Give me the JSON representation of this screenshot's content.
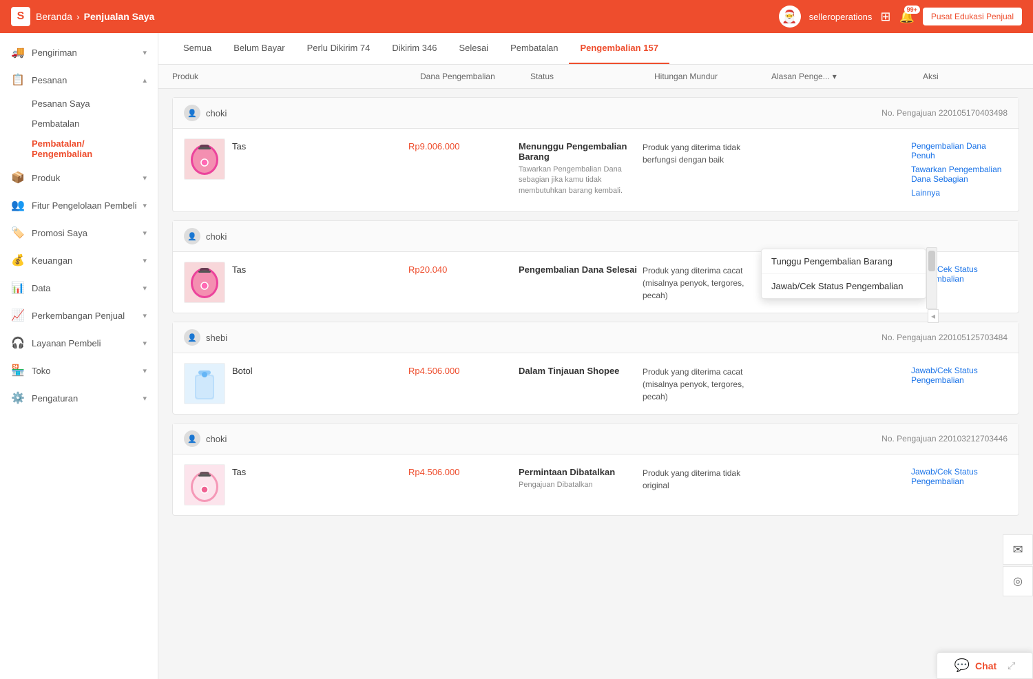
{
  "navbar": {
    "logo": "S",
    "breadcrumb_home": "Beranda",
    "breadcrumb_sep": "›",
    "breadcrumb_current": "Penjualan Saya",
    "username": "selleroperations",
    "notif_badge": "99+",
    "edu_button": "Pusat Edukasi Penjual"
  },
  "sidebar": {
    "items": [
      {
        "id": "pengiriman",
        "icon": "🚚",
        "label": "Pengiriman",
        "chevron": "▾"
      },
      {
        "id": "pesanan",
        "icon": "📋",
        "label": "Pesanan",
        "chevron": "▴",
        "expanded": true
      },
      {
        "id": "produk",
        "icon": "📦",
        "label": "Produk",
        "chevron": "▾"
      },
      {
        "id": "fitur",
        "icon": "👥",
        "label": "Fitur Pengelolaan Pembeli",
        "chevron": "▾"
      },
      {
        "id": "promosi",
        "icon": "🏷️",
        "label": "Promosi Saya",
        "chevron": "▾"
      },
      {
        "id": "keuangan",
        "icon": "💰",
        "label": "Keuangan",
        "chevron": "▾"
      },
      {
        "id": "data",
        "icon": "📊",
        "label": "Data",
        "chevron": "▾"
      },
      {
        "id": "perkembangan",
        "icon": "📈",
        "label": "Perkembangan Penjual",
        "chevron": "▾"
      },
      {
        "id": "layanan",
        "icon": "🎧",
        "label": "Layanan Pembeli",
        "chevron": "▾"
      },
      {
        "id": "toko",
        "icon": "🏪",
        "label": "Toko",
        "chevron": "▾"
      },
      {
        "id": "pengaturan",
        "icon": "⚙️",
        "label": "Pengaturan",
        "chevron": "▾"
      }
    ],
    "sub_pesanan": [
      {
        "id": "pesanan-saya",
        "label": "Pesanan Saya",
        "active": false
      },
      {
        "id": "pembatalan",
        "label": "Pembatalan",
        "active": false
      },
      {
        "id": "pembatalan-pengembalian",
        "label": "Pembatalan/ Pengembalian",
        "active": true
      }
    ]
  },
  "tabs": [
    {
      "id": "semua",
      "label": "Semua",
      "active": false
    },
    {
      "id": "belum-bayar",
      "label": "Belum Bayar",
      "active": false
    },
    {
      "id": "perlu-dikirim",
      "label": "Perlu Dikirim",
      "badge": "74",
      "active": false
    },
    {
      "id": "dikirim",
      "label": "Dikirim",
      "badge": "346",
      "active": false
    },
    {
      "id": "selesai",
      "label": "Selesai",
      "active": false
    },
    {
      "id": "pembatalan",
      "label": "Pembatalan",
      "active": false
    },
    {
      "id": "pengembalian",
      "label": "Pengembalian",
      "badge": "157",
      "active": true
    }
  ],
  "table_header": {
    "produk": "Produk",
    "dana": "Dana Pengembalian",
    "status": "Status",
    "hitungan": "Hitungan Mundur",
    "alasan": "Alasan Penge...",
    "aksi": "Aksi"
  },
  "orders": [
    {
      "id": "order1",
      "user": "choki",
      "submission_no": "No. Pengajuan 220105170403498",
      "product_name": "Tas",
      "product_emoji": "🎒",
      "product_color": "pink",
      "price": "Rp9.006.000",
      "status_main": "Menunggu Pengembalian Barang",
      "status_sub": "Tawarkan Pengembalian Dana sebagian jika kamu tidak membutuhkan barang kembali.",
      "reason": "Produk yang diterima tidak berfungsi dengan baik",
      "actions": [
        {
          "label": "Pengembalian Dana Penuh",
          "type": "primary"
        },
        {
          "label": "Tawarkan Pengembalian Dana Sebagian",
          "type": "primary"
        },
        {
          "label": "Lainnya",
          "type": "primary"
        }
      ]
    },
    {
      "id": "order2",
      "user": "choki",
      "submission_no": "",
      "product_name": "Tas",
      "product_emoji": "🎒",
      "product_color": "pink",
      "price": "Rp20.040",
      "status_main": "Pengembalian Dana Selesai",
      "status_sub": "",
      "reason": "Produk yang diterima cacat (misalnya penyok, tergores, pecah)",
      "actions": [
        {
          "label": "Jawab/Cek Status Pengembalian",
          "type": "primary"
        }
      ]
    },
    {
      "id": "order3",
      "user": "shebi",
      "submission_no": "No. Pengajuan 220105125703484",
      "product_name": "Botol",
      "product_emoji": "🧴",
      "product_color": "blue",
      "price": "Rp4.506.000",
      "status_main": "Dalam Tinjauan Shopee",
      "status_sub": "",
      "reason": "Produk yang diterima cacat (misalnya penyok, tergores, pecah)",
      "actions": [
        {
          "label": "Jawab/Cek Status Pengembalian",
          "type": "primary"
        }
      ]
    },
    {
      "id": "order4",
      "user": "choki",
      "submission_no": "No. Pengajuan 220103212703446",
      "product_name": "Tas",
      "product_emoji": "🎒",
      "product_color": "pink2",
      "price": "Rp4.506.000",
      "status_main": "Permintaan Dibatalkan",
      "status_sub": "Pengajuan Dibatalkan",
      "reason": "Produk yang diterima tidak original",
      "actions": [
        {
          "label": "Jawab/Cek Status Pengembalian",
          "type": "primary"
        }
      ]
    }
  ],
  "dropdown": {
    "items": [
      "Tunggu Pengembalian Barang",
      "Jawab/Cek Status Pengembalian"
    ]
  },
  "chat": {
    "icon": "💬",
    "label": "Chat"
  },
  "float_icons": {
    "email": "✉",
    "headset": "◎"
  }
}
